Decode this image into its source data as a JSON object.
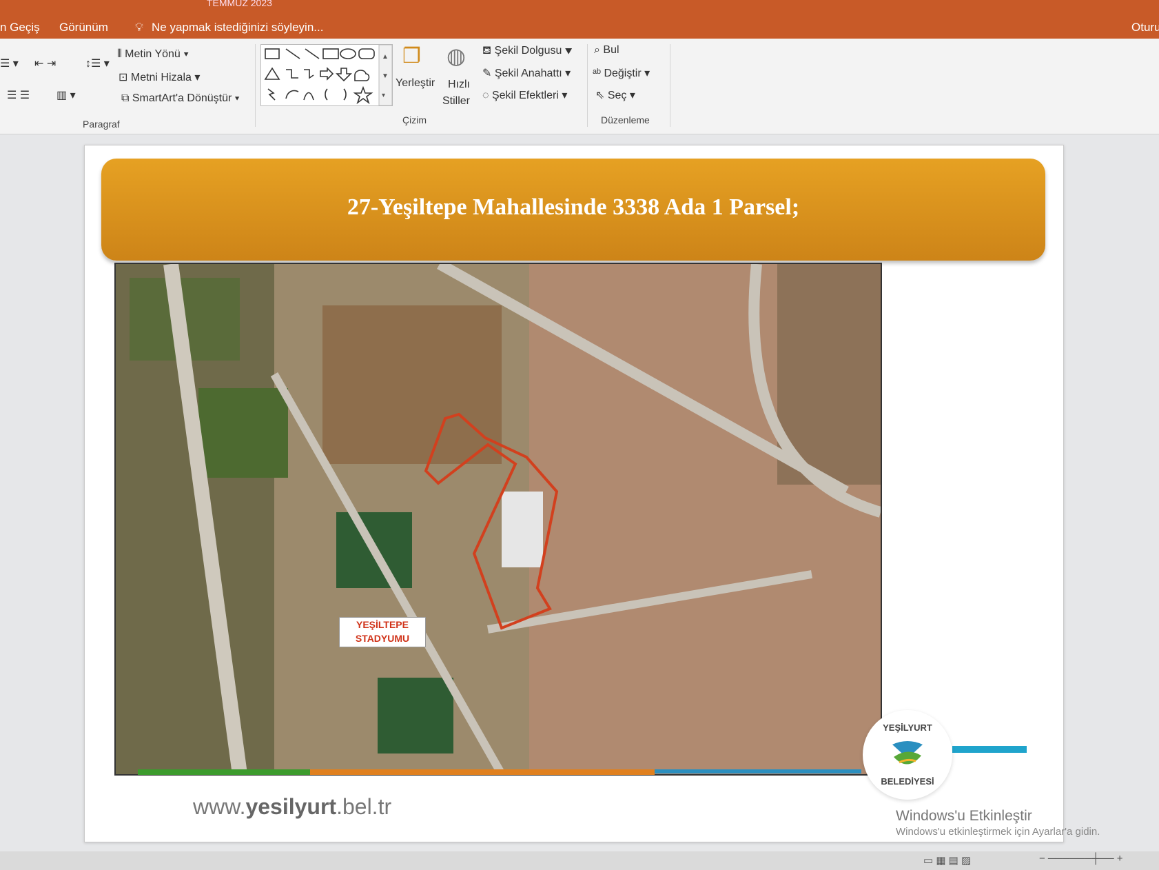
{
  "titlebar": {
    "title_fragment": "TEMMUZ 2023"
  },
  "menu": {
    "items": [
      "n Geçiş",
      "Görünüm"
    ],
    "tell_me": "Ne yapmak istediğinizi söyleyin...",
    "right": "Oturu"
  },
  "ribbon": {
    "paragraph": {
      "text_direction": "Metin Yönü",
      "align_text": "Metni Hizala",
      "smartart": "SmartArt'a Dönüştür",
      "group_label": "Paragraf"
    },
    "drawing": {
      "arrange": "Yerleştir",
      "quick_styles_1": "Hızlı",
      "quick_styles_2": "Stiller",
      "shape_fill": "Şekil Dolgusu",
      "shape_outline": "Şekil Anahattı",
      "shape_effects": "Şekil Efektleri",
      "group_label": "Çizim"
    },
    "editing": {
      "find": "Bul",
      "replace": "Değiştir",
      "select": "Seç",
      "group_label": "Düzenleme"
    }
  },
  "slide": {
    "title": "27-Yeşiltepe Mahallesinde 3338 Ada 1 Parsel;",
    "stadium_label_line1": "YEŞİLTEPE",
    "stadium_label_line2": "STADYUMU",
    "logo_top": "YEŞİLYURT",
    "logo_bottom": "BELEDİYESİ",
    "url_prefix": "www.",
    "url_bold": "yesilyurt",
    "url_suffix": ".bel.tr"
  },
  "activation": {
    "line1": "Windows'u Etkinleştir",
    "line2": "Windows'u etkinleştirmek için Ayarlar'a gidin."
  },
  "colors": {
    "accent": "#c85a28",
    "banner": "#d98e1c",
    "parcel_outline": "#d2401e"
  }
}
